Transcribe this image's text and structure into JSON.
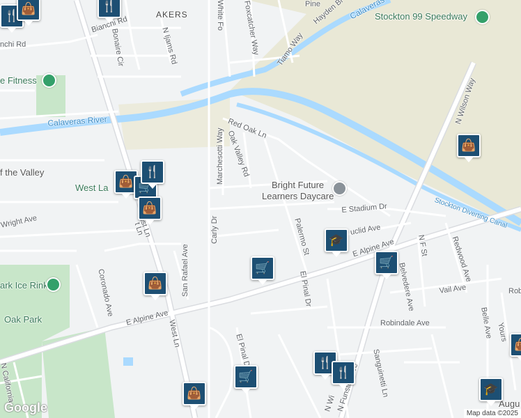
{
  "map": {
    "colors": {
      "land": "#f1f3f4",
      "road": "#ffffff",
      "park": "#c8e6c9",
      "water": "#aadaff",
      "field": "#e9e8d6"
    },
    "labels": {
      "akers": "AKERS",
      "bianchi_rd": "Bianchi Rd",
      "bianchi_rd_2": "nchi Rd",
      "bonaire_cir": "Bonaire Cir",
      "n_ijams_rd": "N Ijams Rd",
      "white_fox": "White Fo",
      "foxcatcher_way": "Foxcatcher Way",
      "tiamo_way": "Tiamo Way",
      "pine": "Pine",
      "hayden_br": "Hayden Br",
      "calaveras_top": "Calaveras",
      "calaveras_river": "Calaveras River",
      "red_oak_ln": "Red Oak Ln",
      "oak_valley_rd": "Oak Valley Rd",
      "marchesotti_way": "Marchesotti Way",
      "carly_dr": "Carly Dr",
      "wright_ave": "Wright Ave",
      "n_wilson_way": "N Wilson Way",
      "e_stadium_dr": "E Stadium Dr",
      "euclid_ave": "uclid Ave",
      "e_alpine_ave_right": "E Alpine Ave",
      "e_alpine_ave_left": "E Alpine Ave",
      "palermo_st": "Palermo St",
      "el_pinal_dr": "El Pinal Dr",
      "el_pinal_dr_2": "El Pinal Dr",
      "n_f_st": "N F St",
      "redwood_ave": "Redwood Ave",
      "belvedere_ave": "Belvedere Ave",
      "vail_ave": "Vail Ave",
      "belle_ave": "Belle Ave",
      "robindale_ave": "Robindale Ave",
      "coronado_ave": "Coronado Ave",
      "san_rafael_ave": "San Rafael Ave",
      "west_ln": "West Ln",
      "west_ln_2": "West Ln",
      "west_ln_3": "t Ln",
      "sanguinetti_ln": "Sanguinetti Ln",
      "n_funston_ave": "N Funston Ave",
      "n_wi": "N Wi",
      "n_california": "N California",
      "stockton_diverting_canal": "Stockton Diverting Canal",
      "stockton_99_speedway": "Stockton 99 Speedway",
      "fitness": "e Fitness",
      "of_the_valley": "f the Valley",
      "west_lane": "West La",
      "bright_future_1": "Bright Future",
      "bright_future_2": "Learners Daycare",
      "ice_rink": "ark Ice Rink",
      "oak_park": "Oak Park",
      "augu": "Augu",
      "yours": "Yours",
      "rob": "Rob"
    },
    "pins": [
      {
        "name": "restaurant",
        "icon": "fork-knife"
      },
      {
        "name": "shopping",
        "icon": "shopping-bag"
      },
      {
        "name": "restaurant",
        "icon": "fork-knife"
      },
      {
        "name": "shopping",
        "icon": "shopping-bag"
      },
      {
        "name": "grocery",
        "icon": "shopping-cart"
      },
      {
        "name": "shopping",
        "icon": "shopping-bag"
      },
      {
        "name": "shopping",
        "icon": "shopping-bag"
      },
      {
        "name": "school",
        "icon": "graduation-cap"
      },
      {
        "name": "grocery",
        "icon": "shopping-cart"
      },
      {
        "name": "grocery",
        "icon": "shopping-cart"
      },
      {
        "name": "shopping",
        "icon": "shopping-bag"
      },
      {
        "name": "restaurant",
        "icon": "fork-knife"
      },
      {
        "name": "restaurant",
        "icon": "fork-knife"
      },
      {
        "name": "grocery",
        "icon": "shopping-cart"
      },
      {
        "name": "shopping",
        "icon": "shopping-bag"
      },
      {
        "name": "school",
        "icon": "graduation-cap"
      },
      {
        "name": "shopping",
        "icon": "shopping-bag"
      }
    ]
  },
  "footer": {
    "logo": "Google",
    "attribution": "Map data ©2025"
  }
}
